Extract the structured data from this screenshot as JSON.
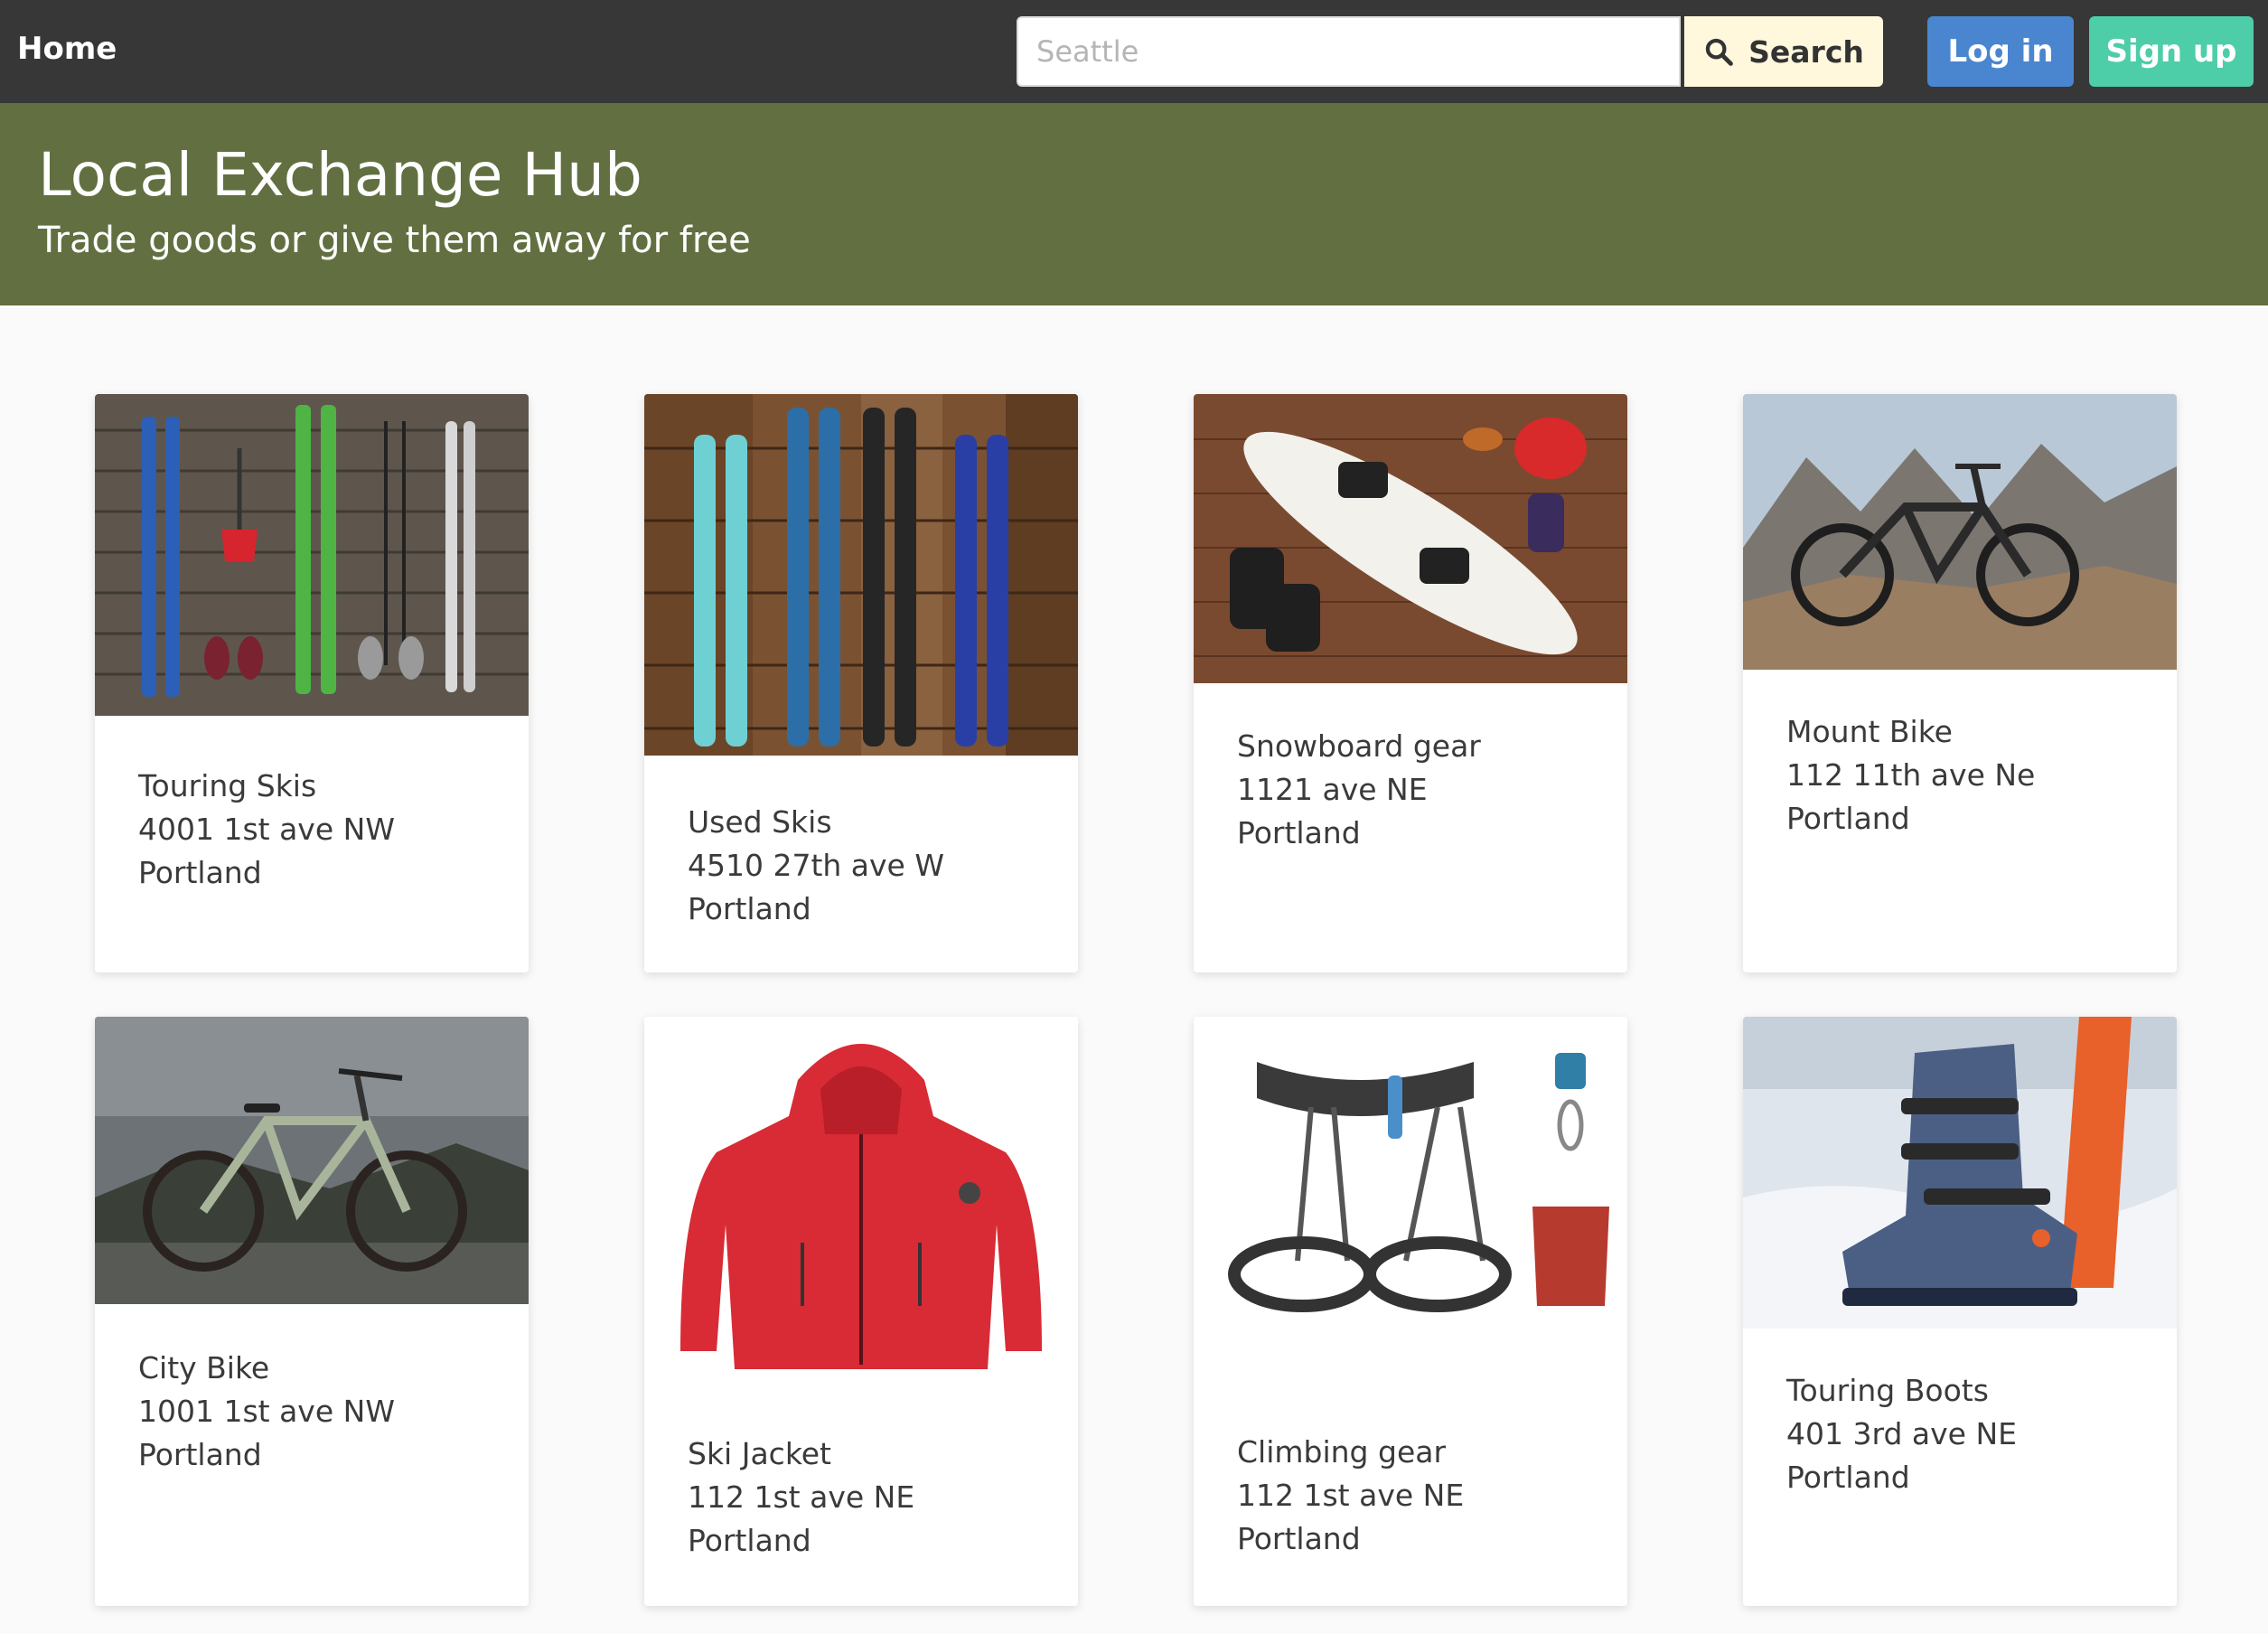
{
  "nav": {
    "home_label": "Home",
    "search_placeholder": "Seattle",
    "search_label": "Search",
    "login_label": "Log in",
    "signup_label": "Sign up"
  },
  "hero": {
    "title": "Local Exchange Hub",
    "subtitle": "Trade goods or give them away for free"
  },
  "listings": [
    {
      "title": "Touring Skis",
      "address": "4001 1st ave NW",
      "city": "Portland",
      "image_icon": "ski-set-photo"
    },
    {
      "title": "Used Skis",
      "address": "4510 27th ave W",
      "city": "Portland",
      "image_icon": "skis-on-wood-photo"
    },
    {
      "title": "Snowboard gear",
      "address": "1121 ave NE",
      "city": "Portland",
      "image_icon": "snowboard-photo"
    },
    {
      "title": "Mount Bike",
      "address": "112 11th ave Ne",
      "city": "Portland",
      "image_icon": "mountain-bike-photo"
    },
    {
      "title": "City Bike",
      "address": "1001 1st ave NW",
      "city": "Portland",
      "image_icon": "city-bike-photo"
    },
    {
      "title": "Ski Jacket",
      "address": "112 1st ave NE",
      "city": "Portland",
      "image_icon": "red-jacket-photo"
    },
    {
      "title": "Climbing gear",
      "address": "112 1st ave NE",
      "city": "Portland",
      "image_icon": "climbing-harness-photo"
    },
    {
      "title": "Touring Boots",
      "address": "401 3rd ave NE",
      "city": "Portland",
      "image_icon": "ski-boot-photo"
    }
  ]
}
